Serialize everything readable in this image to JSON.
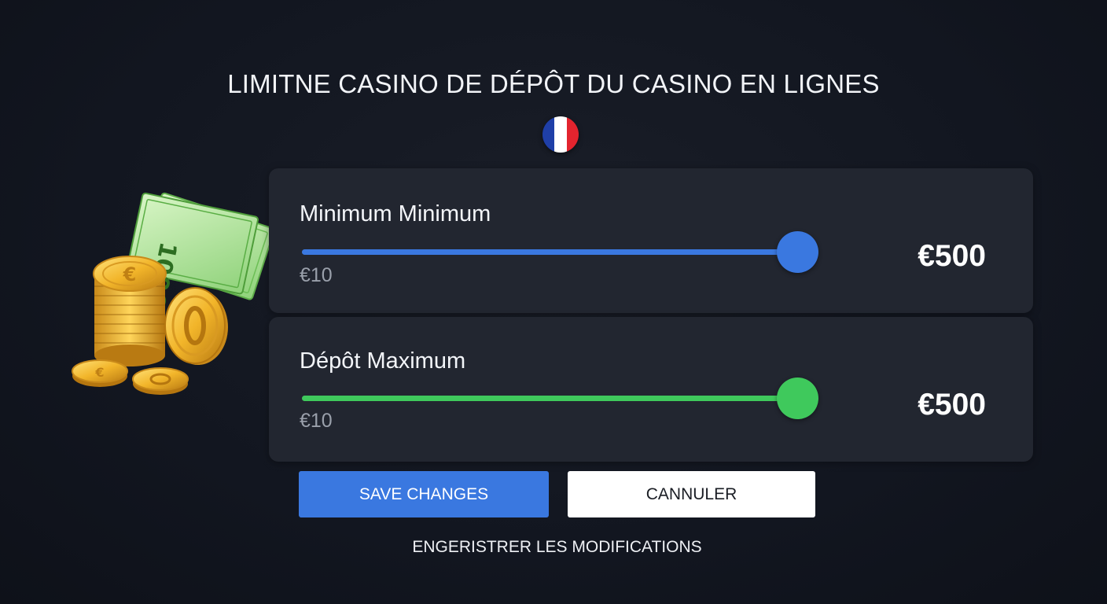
{
  "header": {
    "title": "LIMITNE CASINO DE DÉPÔT DU CASINO EN LIGNES"
  },
  "flag": {
    "icon": "france-flag-icon",
    "colors": [
      "#1f3fa8",
      "#ffffff",
      "#e3242e"
    ]
  },
  "illustration": {
    "icon": "money-coins-icon",
    "banknote_text": "100€"
  },
  "limits": {
    "minimum": {
      "label": "Minimum Minimum",
      "min_label": "€10",
      "value": "€500",
      "slider_fraction": 1.0,
      "accent": "#3a78e0"
    },
    "maximum": {
      "label": "Dépôt Maximum",
      "min_label": "€10",
      "value": "€500",
      "slider_fraction": 1.0,
      "accent": "#3fc95c"
    }
  },
  "actions": {
    "save_label": "SAVE CHANGES",
    "cancel_label": "CANNULER"
  },
  "footer": {
    "note": "ENGERISTRER LES MODIFICATIONS"
  }
}
